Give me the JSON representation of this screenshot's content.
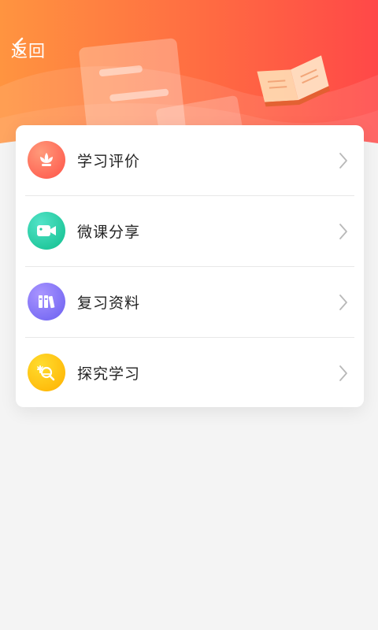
{
  "header": {
    "back_label": "返回",
    "gradient": [
      "#ff8b3d",
      "#ff4b45"
    ]
  },
  "menu": {
    "items": [
      {
        "label": "学习评价",
        "icon": "lotus-icon",
        "colors": [
          "#ff8a6b",
          "#ff5348"
        ]
      },
      {
        "label": "微课分享",
        "icon": "video-camera-icon",
        "colors": [
          "#45dcc0",
          "#12c18f"
        ]
      },
      {
        "label": "复习资料",
        "icon": "books-icon",
        "colors": [
          "#a08bff",
          "#6e63f0"
        ]
      },
      {
        "label": "探究学习",
        "icon": "magnifier-icon",
        "colors": [
          "#ffd31e",
          "#ffb400"
        ]
      }
    ]
  }
}
